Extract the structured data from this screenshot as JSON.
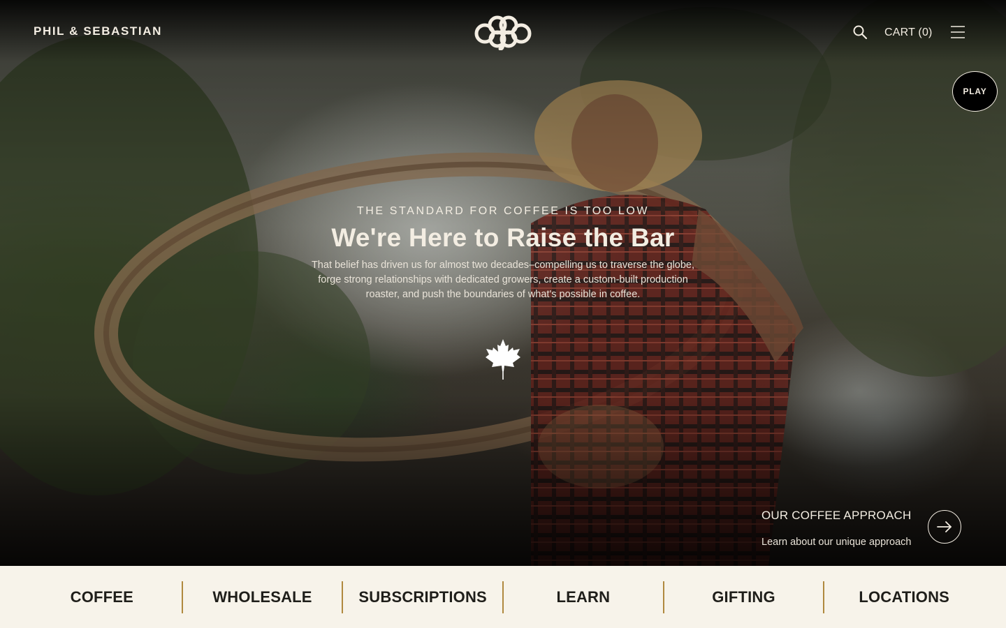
{
  "header": {
    "brand": "PHIL & SEBASTIAN",
    "logo_icon": "interlocking-knot-logo-icon",
    "search_icon": "search-icon",
    "cart_label": "CART (0)",
    "menu_icon": "hamburger-menu-icon"
  },
  "video": {
    "play_label": "PLAY"
  },
  "hero": {
    "eyebrow": "THE STANDARD FOR COFFEE IS TOO LOW",
    "headline": "We're Here to Raise the Bar",
    "body": "That belief has driven us for almost two decades–compelling us to traverse the globe, forge strong relationships with dedicated growers, create a custom-built production roaster, and push the boundaries of what's possible in coffee.",
    "emblem_icon": "maple-leaf-icon"
  },
  "approach": {
    "title": "OUR COFFEE APPROACH",
    "subtitle": "Learn about our unique approach",
    "arrow_icon": "arrow-right-icon"
  },
  "nav": {
    "items": [
      {
        "label": "COFFEE"
      },
      {
        "label": "WHOLESALE"
      },
      {
        "label": "SUBSCRIPTIONS"
      },
      {
        "label": "LEARN"
      },
      {
        "label": "GIFTING"
      },
      {
        "label": "LOCATIONS"
      }
    ]
  },
  "colors": {
    "cream": "#f3ede2",
    "nav_background": "#f7f3ea",
    "nav_text": "#1f1e1a",
    "divider_gold": "#b0893f"
  }
}
